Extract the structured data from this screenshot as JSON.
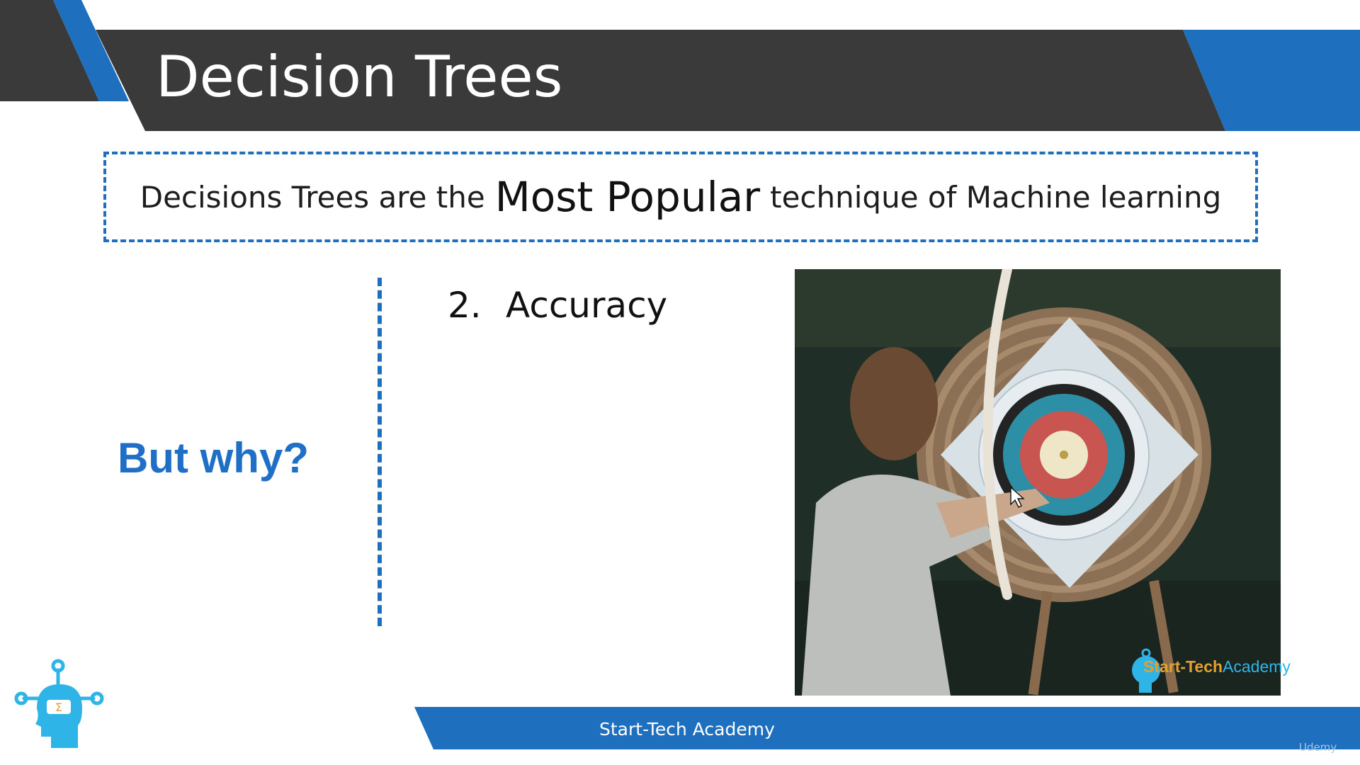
{
  "slide": {
    "title": "Decision Trees",
    "statement": {
      "before": "Decisions Trees are the",
      "emphasis": "Most Popular",
      "after": "technique of Machine learning"
    },
    "question": "But why?",
    "point": {
      "number": "2.",
      "text": "Accuracy"
    }
  },
  "photo": {
    "watermark_start": "Start-Tech",
    "watermark_end": "Academy"
  },
  "footer": {
    "brand": "Start-Tech Academy",
    "platform_mark": "Udemy"
  },
  "colors": {
    "accent_blue": "#1e6fbd",
    "header_dark": "#3a3a3a",
    "question_blue": "#1f6fc6"
  }
}
